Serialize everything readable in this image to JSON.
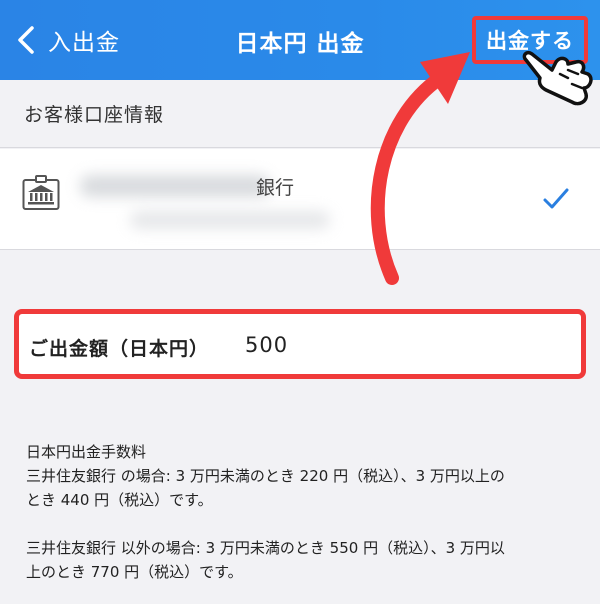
{
  "nav": {
    "back_label": "入出金",
    "title": "日本円 出金",
    "withdraw_button": "出金する"
  },
  "account_section": {
    "header": "お客様口座情報",
    "bank_suffix": "銀行",
    "selected": true
  },
  "amount": {
    "label": "ご出金額（日本円）",
    "value": "500"
  },
  "fees": {
    "title": "日本円出金手数料",
    "smbc": "三井住友銀行 の場合: 3 万円未満のとき 220 円（税込）、3 万円以上の\nとき 440 円（税込）です。",
    "other": "三井住友銀行 以外の場合: 3 万円未満のとき 550 円（税込）、3 万円以\n上のとき 770 円（税込）です。"
  },
  "colors": {
    "nav_blue": "#2a84e6",
    "highlight_red": "#f03a3a",
    "check_blue": "#2a7fe0"
  },
  "icons": [
    "chevron-left-icon",
    "bank-icon",
    "checkmark-icon",
    "curved-arrow-icon",
    "pointing-hand-icon"
  ]
}
